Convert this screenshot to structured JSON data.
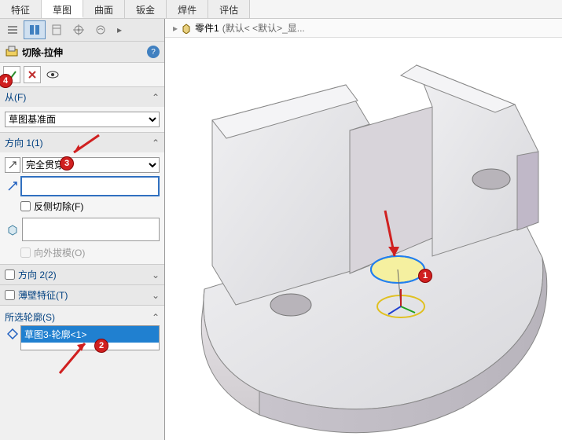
{
  "tabs": [
    "特征",
    "草图",
    "曲面",
    "钣金",
    "焊件",
    "评估"
  ],
  "active_tab": 1,
  "breadcrumb": {
    "part": "零件1",
    "config": "(默认< <默认>_显..."
  },
  "feature": {
    "icon": "cut-extrude-icon",
    "title": "切除-拉伸"
  },
  "sections": {
    "from": {
      "label": "从(F)",
      "value": "草图基准面"
    },
    "direction1": {
      "label": "方向 1(1)",
      "end_condition": "完全贯穿",
      "reverse_cut_label": "反侧切除(F)",
      "reverse_cut_checked": false,
      "distance_value": "",
      "draft_label": "向外拔模(O)",
      "draft_checked": false
    },
    "direction2": {
      "label": "方向 2(2)",
      "checked": false
    },
    "thin": {
      "label": "薄壁特征(T)",
      "checked": false
    },
    "contours": {
      "label": "所选轮廓(S)",
      "items": [
        "草图3-轮廓<1>"
      ]
    }
  },
  "annotations": {
    "1": "1",
    "2": "2",
    "3": "3",
    "4": "4"
  },
  "colors": {
    "accent": "#2080d0",
    "badge": "#d02020"
  }
}
